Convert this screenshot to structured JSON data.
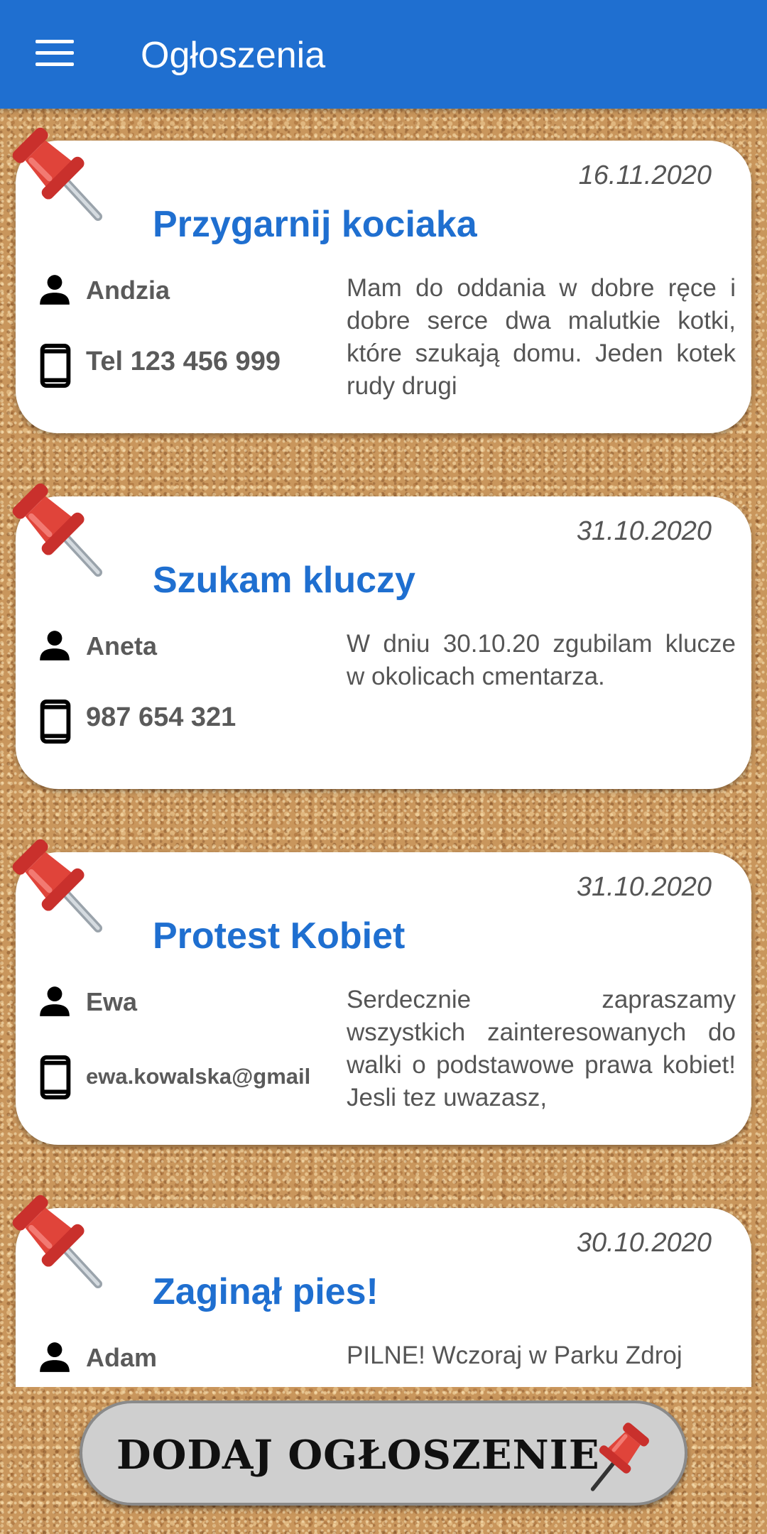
{
  "appbar": {
    "title": "Ogłoszenia",
    "menu_icon": "menu-icon"
  },
  "listings": [
    {
      "date": "16.11.2020",
      "title": "Przygarnij kociaka",
      "author": "Andzia",
      "contact": "Tel 123 456 999",
      "description": "Mam do oddania w dobre ręce i dobre serce dwa malutkie kotki, które szukają domu. Jeden kotek rudy drugi"
    },
    {
      "date": "31.10.2020",
      "title": "Szukam kluczy",
      "author": "Aneta",
      "contact": "987 654 321",
      "description": "W dniu 30.10.20 zgubilam klucze w okolicach cmentarza."
    },
    {
      "date": "31.10.2020",
      "title": "Protest Kobiet",
      "author": "Ewa",
      "contact": "ewa.kowalska@gmail",
      "description": "Serdecznie zapraszamy wszystkich zainteresowanych do walki o podstawowe prawa kobiet! Jesli tez uwazasz,"
    },
    {
      "date": "30.10.2020",
      "title": "Zaginął pies!",
      "author": "Adam",
      "contact": "",
      "description": "PILNE! Wczoraj w Parku Zdroj"
    }
  ],
  "add_button": {
    "label": "DODAJ OGŁOSZENIE",
    "icon": "pushpin-icon"
  },
  "colors": {
    "appbar": "#1f6fd0",
    "title": "#1f6fd0",
    "pin": "#e0443a",
    "background": "#c9965c"
  }
}
